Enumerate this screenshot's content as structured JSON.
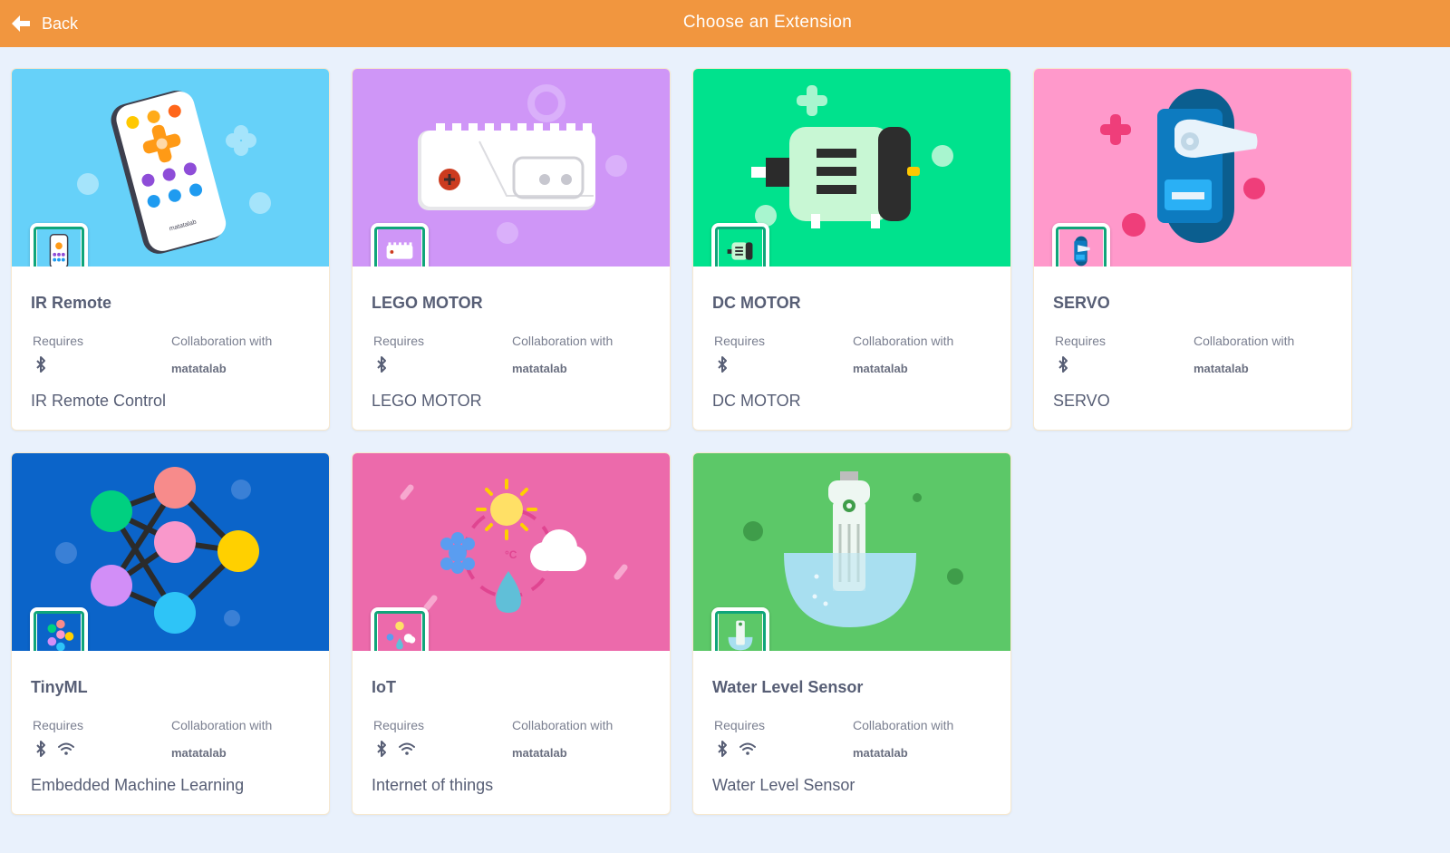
{
  "header": {
    "back_label": "Back",
    "title": "Choose an Extension",
    "color": "#f1963f"
  },
  "labels": {
    "requires": "Requires",
    "collaboration": "Collaboration with"
  },
  "cards": [
    {
      "title": "IR Remote",
      "collaborator": "matatalab",
      "description": "IR Remote Control",
      "requires": [
        "bluetooth"
      ],
      "bg": "#66d1f9",
      "remote_text": "matatalab"
    },
    {
      "title": "LEGO MOTOR",
      "collaborator": "matatalab",
      "description": "LEGO MOTOR",
      "requires": [
        "bluetooth"
      ],
      "bg": "#cf96f7"
    },
    {
      "title": "DC MOTOR",
      "collaborator": "matatalab",
      "description": "DC MOTOR",
      "requires": [
        "bluetooth"
      ],
      "bg": "#00e28d"
    },
    {
      "title": "SERVO",
      "collaborator": "matatalab",
      "description": "SERVO",
      "requires": [
        "bluetooth"
      ],
      "bg": "#ff99cb"
    },
    {
      "title": "TinyML",
      "collaborator": "matatalab",
      "description": "Embedded Machine Learning",
      "requires": [
        "bluetooth",
        "wifi"
      ],
      "bg": "#0b64c9"
    },
    {
      "title": "IoT",
      "collaborator": "matatalab",
      "description": "Internet of things",
      "requires": [
        "bluetooth",
        "wifi"
      ],
      "bg": "#ec6aab",
      "art_text": "°C"
    },
    {
      "title": "Water Level Sensor",
      "collaborator": "matatalab",
      "description": "Water Level Sensor",
      "requires": [
        "bluetooth",
        "wifi"
      ],
      "bg": "#5cc868"
    }
  ],
  "icons": {
    "back": "arrow-left-icon",
    "bluetooth": "bluetooth-icon",
    "wifi": "wifi-icon"
  }
}
